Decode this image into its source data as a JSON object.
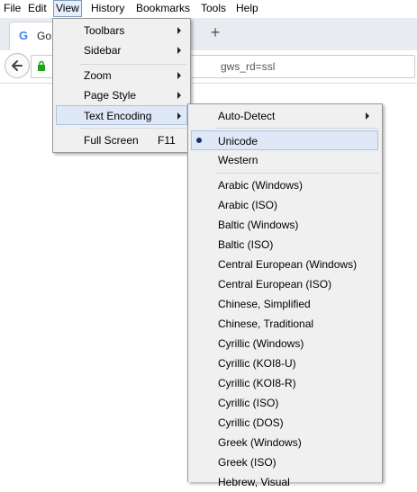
{
  "menubar": {
    "items": [
      "File",
      "Edit",
      "View",
      "History",
      "Bookmarks",
      "Tools",
      "Help"
    ]
  },
  "tab": {
    "title": "Go"
  },
  "urlbar": {
    "text": "gws_rd=ssl"
  },
  "icons": {
    "google": "google-favicon",
    "new_tab": "plus-icon",
    "back": "back-arrow-icon",
    "secure": "lock-icon",
    "submenu": "chevron-right-icon",
    "selected": "radio-dot-icon"
  },
  "colors": {
    "menu_bg": "#f0f0f0",
    "highlight": "#dfe8f6",
    "highlight_border": "#a8c3e6",
    "lock": "#1ca51c"
  },
  "view_menu": {
    "items": [
      {
        "label": "Toolbars",
        "submenu": true
      },
      {
        "label": "Sidebar",
        "submenu": true
      },
      {
        "label": "Zoom",
        "submenu": true
      },
      {
        "label": "Page Style",
        "submenu": true
      },
      {
        "label": "Text Encoding",
        "submenu": true,
        "highlighted": true
      },
      {
        "label": "Full Screen",
        "shortcut": "F11"
      }
    ]
  },
  "encoding_menu": {
    "auto_detect": "Auto-Detect",
    "selected": "Unicode",
    "unicode": "Unicode",
    "western": "Western",
    "encodings": [
      "Arabic (Windows)",
      "Arabic (ISO)",
      "Baltic (Windows)",
      "Baltic (ISO)",
      "Central European (Windows)",
      "Central European (ISO)",
      "Chinese, Simplified",
      "Chinese, Traditional",
      "Cyrillic (Windows)",
      "Cyrillic (KOI8-U)",
      "Cyrillic (KOI8-R)",
      "Cyrillic (ISO)",
      "Cyrillic (DOS)",
      "Greek (Windows)",
      "Greek (ISO)",
      "Hebrew, Visual"
    ]
  }
}
